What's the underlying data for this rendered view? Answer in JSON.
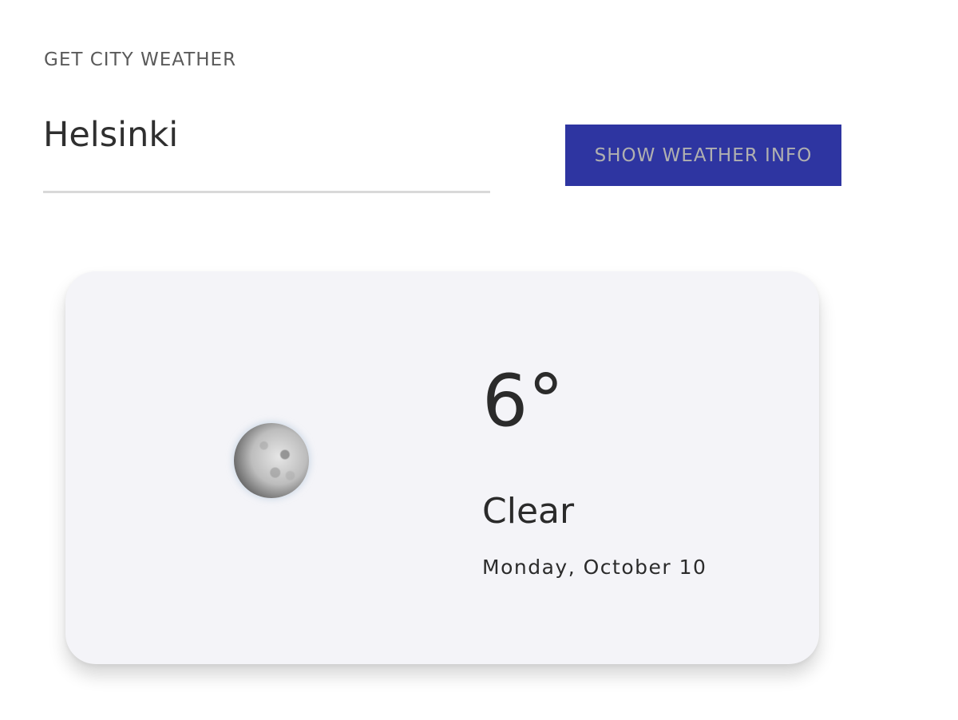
{
  "form": {
    "title": "GET CITY WEATHER",
    "city_input_value": "Helsinki",
    "show_button_label": "SHOW WEATHER INFO"
  },
  "weather": {
    "icon": "moon-icon",
    "temperature": "6°",
    "condition": "Clear",
    "date": "Monday, October 10"
  },
  "colors": {
    "button_background": "#2e35a1",
    "card_background": "#f4f4f8",
    "text": "#2b2b2b"
  }
}
